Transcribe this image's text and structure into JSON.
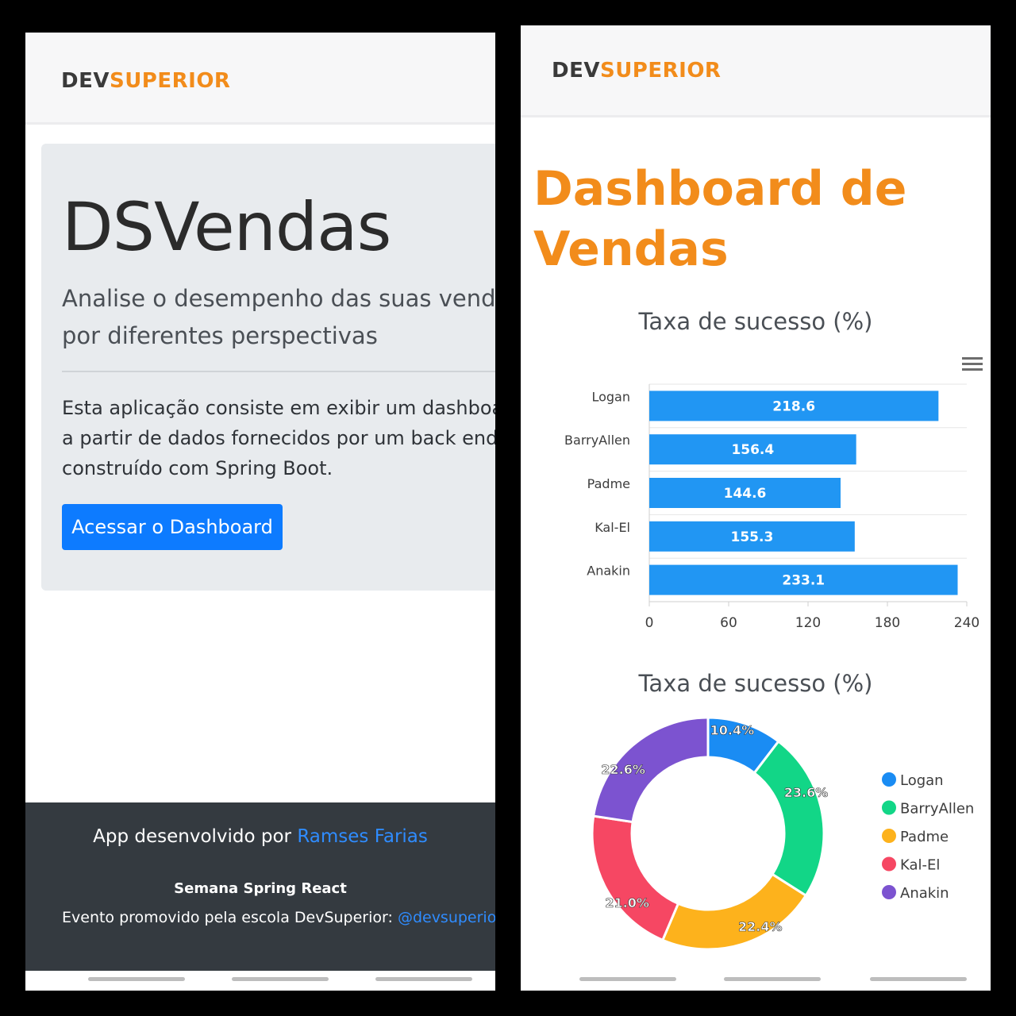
{
  "left": {
    "logo": {
      "dev": "DEV",
      "superior": "SUPERIOR"
    },
    "jumbotron": {
      "title": "DSVendas",
      "lead_line1": "Analise o desempenho das suas vendas",
      "lead_line2": "por diferentes perspectivas",
      "text_line1": "Esta aplicação consiste em exibir um dashboard",
      "text_line2": "a partir de dados fornecidos por um back end",
      "text_line3": "construído com Spring Boot.",
      "button_label": "Acessar o Dashboard"
    },
    "footer": {
      "line1_prefix": "App desenvolvido por ",
      "author_link": "Ramses Farias",
      "line2": "Semana Spring React",
      "line3_prefix": "Evento promovido pela escola DevSuperior: ",
      "instagram_link": "@devsuperior.ig"
    }
  },
  "right": {
    "logo": {
      "dev": "DEV",
      "superior": "SUPERIOR"
    },
    "page_title_line1": "Dashboard de",
    "page_title_line2": "Vendas",
    "menu_icon": "hamburger-menu-icon",
    "colors": {
      "bar": "#2196f3",
      "accent": "#f28c1b"
    }
  },
  "chart_data": [
    {
      "type": "bar",
      "orientation": "horizontal",
      "title": "Taxa de sucesso (%)",
      "categories": [
        "Logan",
        "BarryAllen",
        "Padme",
        "Kal-El",
        "Anakin"
      ],
      "values": [
        218.6,
        156.4,
        144.6,
        155.3,
        233.1
      ],
      "xlim": [
        0,
        240
      ],
      "xticks": [
        0,
        60,
        120,
        180,
        240
      ],
      "data_labels": true,
      "color": "#2196f3"
    },
    {
      "type": "pie",
      "variant": "donut",
      "title": "Taxa de sucesso (%)",
      "labels": [
        "Logan",
        "BarryAllen",
        "Padme",
        "Kal-El",
        "Anakin"
      ],
      "values": [
        10.4,
        23.6,
        22.4,
        21.0,
        22.6
      ],
      "value_labels": [
        "10.4%",
        "23.6%",
        "22.4%",
        "21.0%",
        "22.6%"
      ],
      "colors": [
        "#1a8cf3",
        "#12d687",
        "#fdb21c",
        "#f64763",
        "#7c53d0"
      ],
      "legend": "right"
    }
  ]
}
